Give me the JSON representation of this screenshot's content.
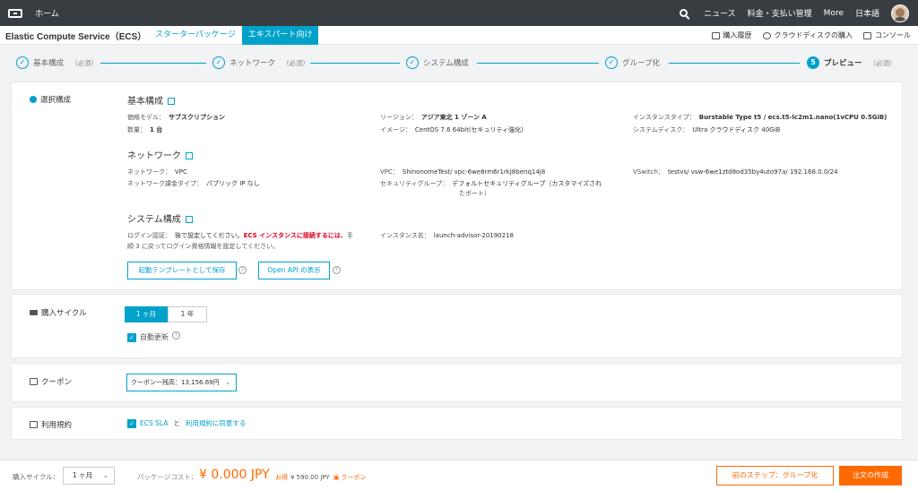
{
  "topbar": {
    "home": "ホーム",
    "news": "ニュース",
    "billing": "料金・支払い管理",
    "more": "More",
    "lang": "日本語"
  },
  "subbar": {
    "title": "Elastic Compute Service（ECS）",
    "tabs": [
      {
        "label": "スターターパッケージ"
      },
      {
        "label": "エキスパート向け"
      }
    ],
    "links": [
      {
        "label": "購入履歴"
      },
      {
        "label": "クラウドディスクの購入"
      },
      {
        "label": "コンソール"
      }
    ]
  },
  "steps": [
    {
      "label": "基本構成",
      "req": "（必須）",
      "state": "done"
    },
    {
      "label": "ネットワーク",
      "req": "（必須）",
      "state": "done"
    },
    {
      "label": "システム構成",
      "req": "",
      "state": "done"
    },
    {
      "label": "グループ化",
      "req": "",
      "state": "done"
    },
    {
      "num": "5",
      "label": "プレビュー",
      "req": "（必須）",
      "state": "current"
    }
  ],
  "config": {
    "label": "選択構成",
    "basic": {
      "title": "基本構成",
      "billing_k": "価格モデル：",
      "billing_v": "サブスクリプション",
      "region_k": "リージョン：",
      "region_v": "アジア東北 1 ゾーン A",
      "instance_k": "インスタンスタイプ：",
      "instance_v": "Burstable Type t5 / ecs.t5-lc2m1.nano(1vCPU 0.5GiB)",
      "qty_k": "数量：",
      "qty_v": "1 台",
      "image_k": "イメージ：",
      "image_v": "CentOS 7.6 64bit(セキュリティ強化)",
      "disk_k": "システムディスク：",
      "disk_v": "Ultra クラウドディスク 40GiB"
    },
    "network": {
      "title": "ネットワーク",
      "net_k": "ネットワーク：",
      "net_v": "VPC",
      "vpc_k": "VPC：",
      "vpc_v": "ShinonomeTest/ vpc-6we8rm6r1rkj8benq14j8",
      "vsw_k": "VSwitch：",
      "vsw_v": "testvs/ vsw-6we1ztd8od35by4uto97a/ 192.168.0.0/24",
      "bill_k": "ネットワーク課金タイプ：",
      "bill_v": "パブリック IP なし",
      "sg_k": "セキュリティグループ：",
      "sg_v1": "デフォルトセキュリティグループ（カスタマイズされ",
      "sg_v2": "たポート）"
    },
    "system": {
      "title": "システム構成",
      "login_k": "ログイン認証：",
      "login_v1": "後で設定してください。",
      "login_red": "ECS インスタンスに接続するには、",
      "login_v2": "手",
      "login_v3": "順 3 に戻ってログイン資格情報を設定してください。",
      "name_k": "インスタンス名：",
      "name_v": "launch-advisor-20190218"
    },
    "btn_template": "起動テンプレートとして保存",
    "btn_api": "Open API の表示"
  },
  "cycle": {
    "label": "購入サイクル",
    "options": [
      "1 ヶ月",
      "1 年"
    ],
    "auto_renew": "自動更新"
  },
  "coupon": {
    "label": "クーポン",
    "select": "クーポン一残高：13,156.69円"
  },
  "terms": {
    "label": "利用規約",
    "sla": "ECS SLA",
    "and": "と",
    "agree": "利用規約に同意する"
  },
  "bottom": {
    "cycle_label": "購入サイクル：",
    "cycle_value": "1 ヶ月",
    "cost_label": "パッケージコスト：",
    "price": "¥ 0.000 JPY",
    "save_label": "お得",
    "save_value": "¥ 590.00 JPY",
    "coupon": "クーポン",
    "prev_btn": "前のステップ：グループ化",
    "order_btn": "注文の作成"
  },
  "colors": {
    "accent": "#00a2ca",
    "price": "#ff6a00",
    "topbar": "#373d41"
  }
}
